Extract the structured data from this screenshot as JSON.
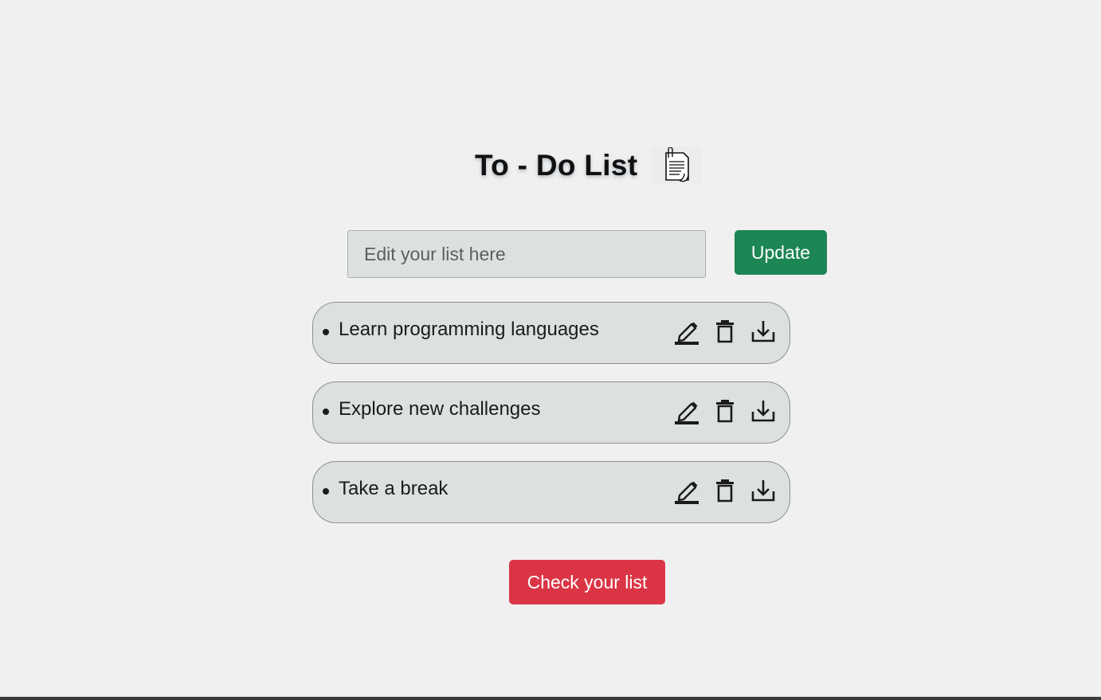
{
  "header": {
    "title": "To - Do List",
    "icon": "notepad-icon"
  },
  "editor": {
    "placeholder": "Edit your list here",
    "value": "",
    "update_label": "Update"
  },
  "todos": [
    {
      "text": "Learn programming languages",
      "actions": [
        "edit-icon",
        "trash-icon",
        "download-icon"
      ]
    },
    {
      "text": "Explore new challenges",
      "actions": [
        "edit-icon",
        "trash-icon",
        "download-icon"
      ]
    },
    {
      "text": "Take a break",
      "actions": [
        "edit-icon",
        "trash-icon",
        "download-icon"
      ]
    }
  ],
  "footer": {
    "check_label": "Check your list"
  },
  "colors": {
    "background": "#f0f0f0",
    "update_button": "#1c8654",
    "check_button": "#db3545",
    "item_background": "#dce1e0"
  }
}
